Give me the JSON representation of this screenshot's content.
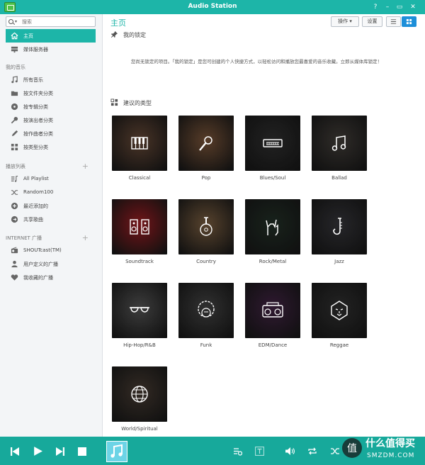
{
  "window": {
    "title": "Audio Station",
    "help": "?",
    "minimize": "–",
    "maximize": "▭",
    "close": "✕"
  },
  "search": {
    "placeholder": "搜索"
  },
  "sidebar": {
    "top_items": [
      {
        "label": "主页",
        "icon": "home-icon"
      },
      {
        "label": "媒体服务器",
        "icon": "media-server-icon"
      }
    ],
    "sections": {
      "my_music": "我的音乐",
      "playlists": "播放列表",
      "radio": "INTERNET 广播"
    },
    "music_items": [
      {
        "label": "所有音乐",
        "icon": "music-note-icon"
      },
      {
        "label": "按文件夹分类",
        "icon": "folder-icon"
      },
      {
        "label": "按专辑分类",
        "icon": "album-icon"
      },
      {
        "label": "按演出者分类",
        "icon": "microphone-icon"
      },
      {
        "label": "按作曲者分类",
        "icon": "pen-icon"
      },
      {
        "label": "按类型分类",
        "icon": "grid-icon"
      }
    ],
    "playlist_items": [
      {
        "label": "All Playlist",
        "icon": "playlist-icon"
      },
      {
        "label": "Random100",
        "icon": "shuffle-icon"
      },
      {
        "label": "最近添加的",
        "icon": "plus-circle-icon"
      },
      {
        "label": "共享歌曲",
        "icon": "share-icon"
      }
    ],
    "radio_items": [
      {
        "label": "SHOUTcast(TM)",
        "icon": "radio-icon"
      },
      {
        "label": "用户定义的广播",
        "icon": "user-icon"
      },
      {
        "label": "我收藏的广播",
        "icon": "heart-icon"
      }
    ]
  },
  "main": {
    "title": "主页",
    "toolbar": {
      "actions": "操作 ▾",
      "settings": "设置"
    },
    "pinned": {
      "title": "我的锁定",
      "description": "您尚无锁定的项目。「我的锁定」是您可创建的个人快捷方式，以轻松访问和播放您最喜爱的音乐收藏。立即从媒体库锁定！"
    },
    "genres": {
      "title": "建议的类型",
      "items": [
        {
          "label": "Classical",
          "icon": "piano-icon",
          "color": "#5a4030"
        },
        {
          "label": "Pop",
          "icon": "microphone-icon",
          "color": "#6b4a32"
        },
        {
          "label": "Blues/Soul",
          "icon": "harmonica-icon",
          "color": "#2a2a2a"
        },
        {
          "label": "Ballad",
          "icon": "music-note-icon",
          "color": "#3a3632"
        },
        {
          "label": "Soundtrack",
          "icon": "speakers-icon",
          "color": "#8a1a1e"
        },
        {
          "label": "Country",
          "icon": "guitar-icon",
          "color": "#6b5238"
        },
        {
          "label": "Rock/Metal",
          "icon": "rock-hand-icon",
          "color": "#1e2a22"
        },
        {
          "label": "Jazz",
          "icon": "saxophone-icon",
          "color": "#2f2f33"
        },
        {
          "label": "Hip-Hop/R&B",
          "icon": "sunglasses-icon",
          "color": "#4a4a4a"
        },
        {
          "label": "Funk",
          "icon": "afro-icon",
          "color": "#3c3c3c"
        },
        {
          "label": "EDM/Dance",
          "icon": "boombox-icon",
          "color": "#3a1f3c"
        },
        {
          "label": "Reggae",
          "icon": "lion-icon",
          "color": "#2b2b2b"
        },
        {
          "label": "World/Spiritual",
          "icon": "globe-icon",
          "color": "#3e342c"
        }
      ]
    }
  },
  "player": {
    "controls": [
      "previous-icon",
      "play-icon",
      "next-icon",
      "stop-icon"
    ],
    "right_controls": [
      "queue-icon",
      "lyrics-icon",
      "volume-icon",
      "repeat-icon",
      "shuffle-icon"
    ]
  },
  "watermark": {
    "text": "什么值得买",
    "sub": "SMZDM.COM",
    "glyph": "值"
  },
  "colors": {
    "accent": "#1db5a8",
    "player": "#17a99b",
    "selected_view": "#1d8fd9"
  }
}
